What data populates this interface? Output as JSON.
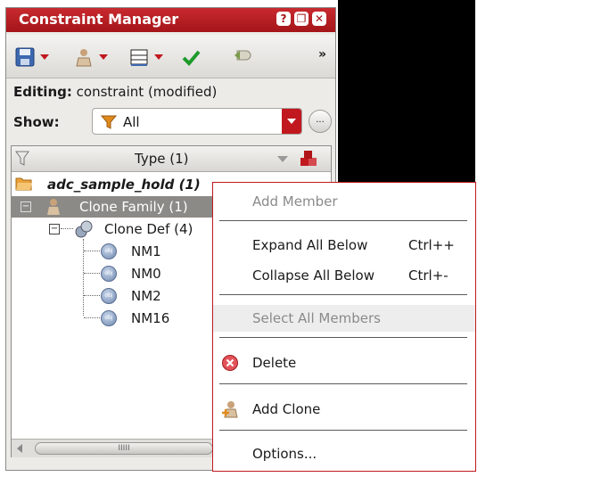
{
  "panel": {
    "title": "Constraint Manager",
    "title_buttons": [
      "?",
      "❐",
      "✕"
    ],
    "toolbar_overflow": "»"
  },
  "editing": {
    "label": "Editing:",
    "value": "constraint (modified)"
  },
  "show": {
    "label": "Show:",
    "selected": "All",
    "more_label": "..."
  },
  "tree": {
    "header": "Type (1)",
    "root": "adc_sample_hold (1)",
    "family": "Clone Family (1)",
    "def": "Clone Def (4)",
    "members": [
      "NM1",
      "NM0",
      "NM2",
      "NM16"
    ],
    "obj_icon_text": "obj",
    "scroll_grip": "IIIII"
  },
  "menu": {
    "add_member": "Add Member",
    "expand_all": "Expand All Below",
    "expand_sc": "Ctrl++",
    "collapse_all": "Collapse All Below",
    "collapse_sc": "Ctrl+-",
    "select_all": "Select All Members",
    "delete": "Delete",
    "add_clone": "Add Clone",
    "options": "Options..."
  },
  "colors": {
    "accent": "#c0181e",
    "title_bar": "#b2191f",
    "selection": "#8c8a86"
  }
}
